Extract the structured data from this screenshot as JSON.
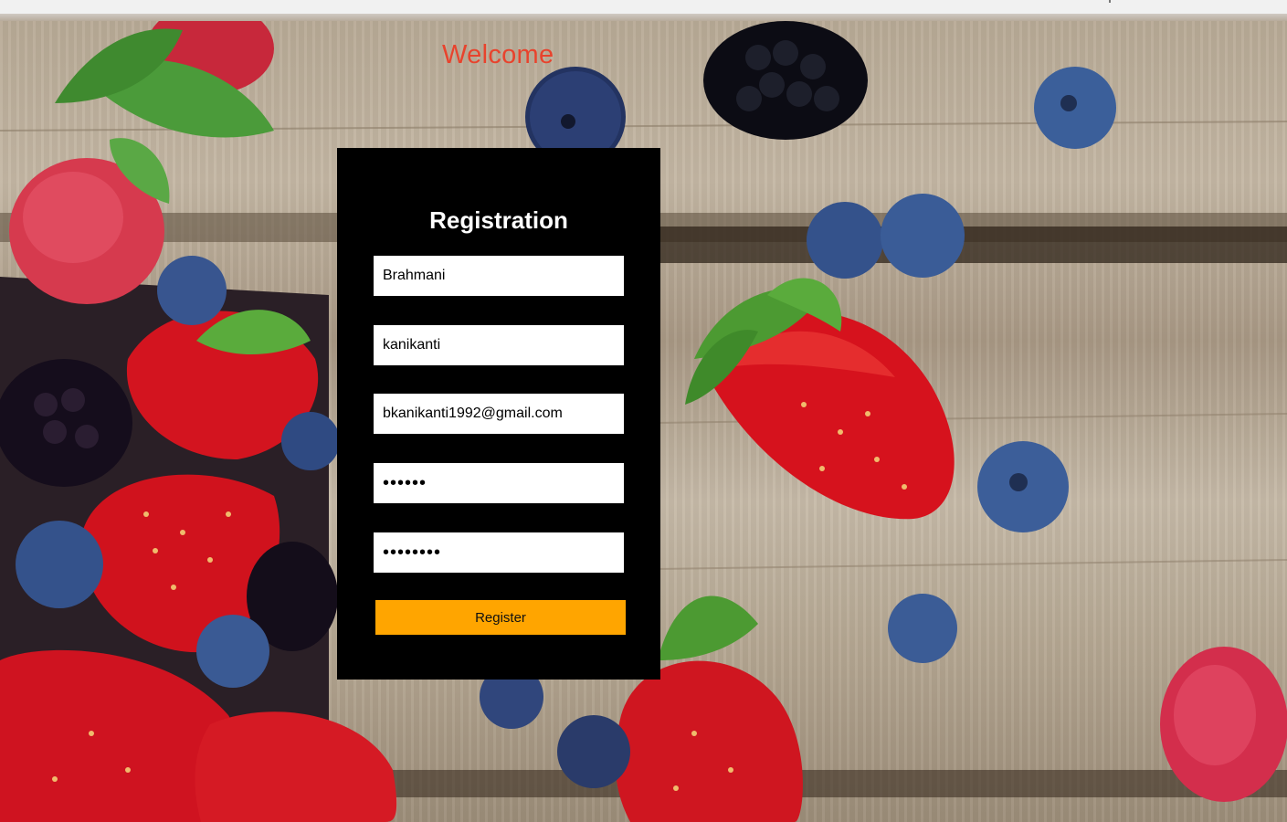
{
  "header": {
    "welcome": "Welcome"
  },
  "form": {
    "title": "Registration",
    "first_name_value": "Brahmani",
    "last_name_value": "kanikanti",
    "email_value": "bkanikanti1992@gmail.com",
    "password_value": "••••••",
    "confirm_password_value": "••••••••",
    "register_label": "Register"
  },
  "colors": {
    "welcome": "#e8432d",
    "panel": "#000000",
    "button": "#ffa500"
  }
}
